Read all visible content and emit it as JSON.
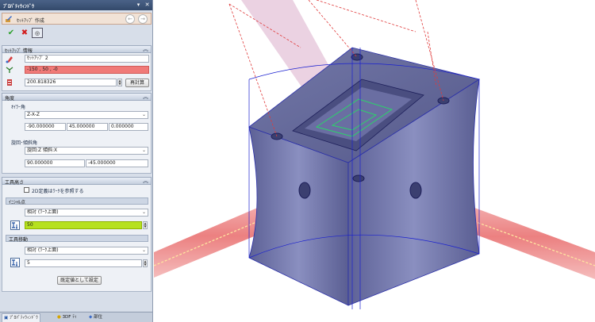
{
  "panel": {
    "title": "ﾌﾟﾛﾊﾟﾃｨｳｨﾝﾄﾞｳ",
    "command_title": "ｾｯﾄｱｯﾌﾟ 作成",
    "setup_info": {
      "header": "ｾｯﾄｱｯﾌﾟ 情報",
      "name_value": "ｾｯﾄｱｯﾌﾟ 2",
      "origin_value": "-150 , 50 , -0",
      "distance_value": "200.818326",
      "recalc_label": "再計算"
    },
    "angle": {
      "header": "角度",
      "euler_label": "ｵｲﾗｰ角",
      "euler_order": "Z-X-Z",
      "euler_values": [
        "-90.000000",
        "45.000000",
        "0.000000"
      ],
      "tilt_label": "旋回･傾斜角",
      "tilt_mode": "旋回:Z 傾斜:X",
      "tilt_values": [
        "90.000000",
        "-45.000000"
      ]
    },
    "tool_height": {
      "header": "工具高さ",
      "checkbox_label": "2D定義はﾜｰｸを参照する",
      "initial_point": {
        "header": "ｲﾆｼｬﾙ点",
        "mode": "相対 (ﾜｰｸ上面)",
        "value": "50"
      },
      "tool_move": {
        "header": "工具移動",
        "mode": "相対 (ﾜｰｸ上面)",
        "value": "5"
      },
      "default_button": "既定値として設定"
    },
    "bottom_tabs": [
      "ﾌﾟﾛﾊﾟﾃｨｳｨﾝﾄﾞｳ",
      "3DF ﾃｨ",
      "部位"
    ]
  },
  "colors": {
    "panel_bg": "#d7dee9",
    "title_bar": "#3b5278",
    "origin_field": "#f07a78",
    "initial_value_field": "#b6e11f",
    "part_body": "#6f74aa",
    "tool_axis": "#e85a5a"
  }
}
